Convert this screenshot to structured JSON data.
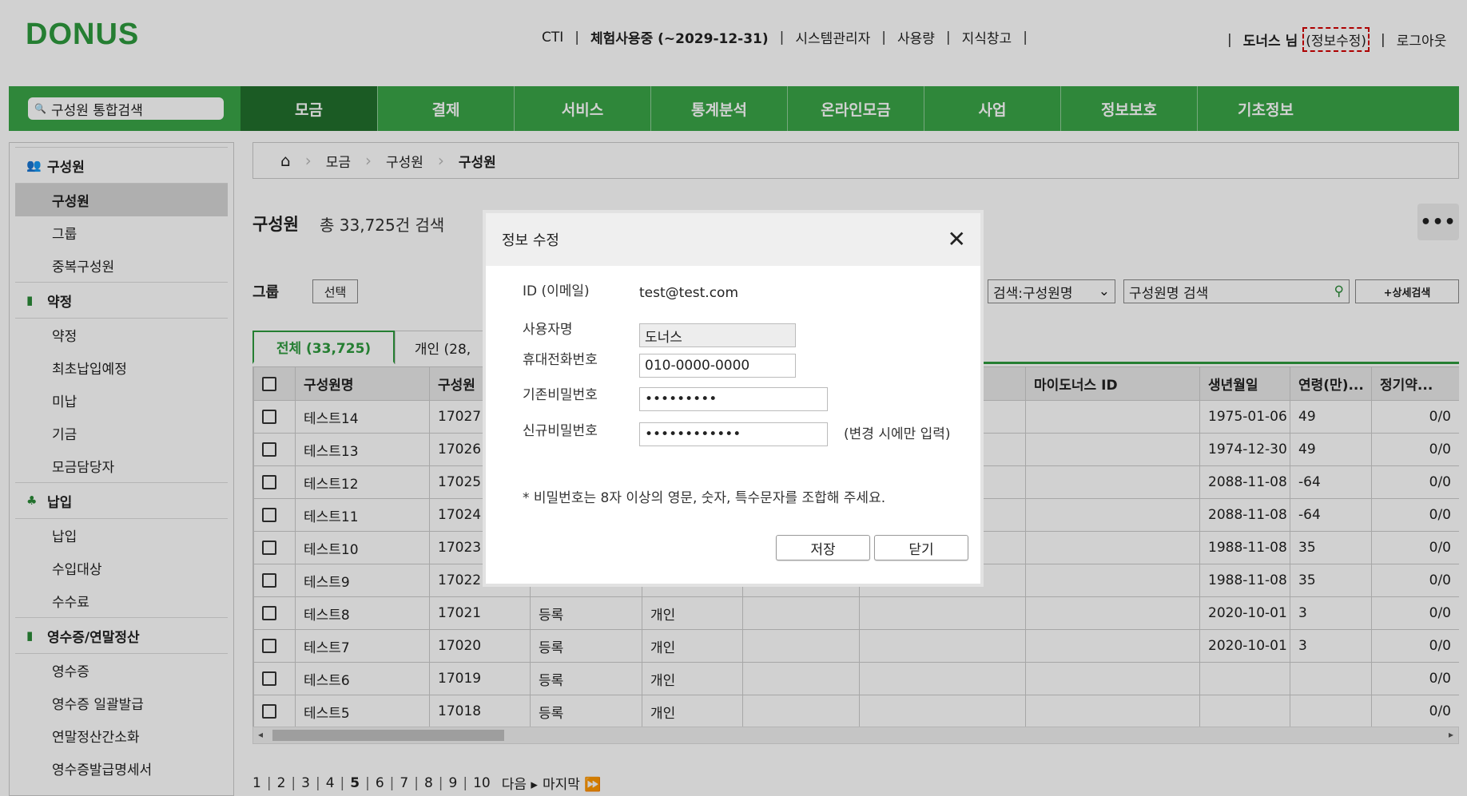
{
  "app": {
    "logo": "DONUS"
  },
  "topnav": {
    "cti": "CTI",
    "trial": "체험사용중 (~2029-12-31)",
    "sysadmin": "시스템관리자",
    "usage": "사용량",
    "knowledge": "지식창고",
    "user_name": "도너스 님",
    "edit_info": "(정보수정)",
    "logout": "로그아웃",
    "separator": "|"
  },
  "menubar": {
    "search_placeholder": "구성원 통합검색",
    "items": [
      "모금",
      "결제",
      "서비스",
      "통계분석",
      "온라인모금",
      "사업",
      "정보보호",
      "기초정보"
    ],
    "active_index": 0
  },
  "sidebar": {
    "sections": [
      {
        "title": "구성원",
        "icon": "people-icon",
        "items": [
          "구성원",
          "그룹",
          "중복구성원"
        ]
      },
      {
        "title": "약정",
        "icon": "document-icon",
        "items": [
          "약정",
          "최초납입예정",
          "미납",
          "기금",
          "모금담당자"
        ]
      },
      {
        "title": "납입",
        "icon": "bell-icon",
        "items": [
          "납입",
          "수입대상",
          "수수료"
        ]
      },
      {
        "title": "영수증/연말정산",
        "icon": "receipt-icon",
        "items": [
          "영수증",
          "영수증 일괄발급",
          "연말정산간소화",
          "영수증발급명세서"
        ]
      }
    ],
    "active_item": "구성원"
  },
  "breadcrumb": [
    "모금",
    "구성원",
    "구성원"
  ],
  "page": {
    "title": "구성원",
    "count_text": "총 33,725건 검색",
    "more": "•••"
  },
  "filters": {
    "group_label": "그룹",
    "group_button": "선택",
    "search_select": "검색:구성원명",
    "search_placeholder": "구성원명 검색",
    "advanced_button": "+상세검색"
  },
  "tabs": [
    "전체 (33,725)",
    "개인 (28,"
  ],
  "table": {
    "columns": [
      "",
      "구성원명",
      "구성원",
      "",
      "",
      "",
      "",
      "마이도너스 ID",
      "생년월일",
      "연령(만)...",
      "정기약...",
      "("
    ],
    "rows": [
      [
        "테스트14",
        "17027",
        "",
        "",
        "",
        "",
        "",
        "1975-01-06",
        "49",
        "0/0"
      ],
      [
        "테스트13",
        "17026",
        "",
        "",
        "",
        "",
        "",
        "1974-12-30",
        "49",
        "0/0"
      ],
      [
        "테스트12",
        "17025",
        "",
        "",
        "",
        "",
        "",
        "2088-11-08",
        "-64",
        "0/0"
      ],
      [
        "테스트11",
        "17024",
        "",
        "",
        "",
        "",
        "",
        "2088-11-08",
        "-64",
        "0/0"
      ],
      [
        "테스트10",
        "17023",
        "",
        "",
        "",
        "",
        "",
        "1988-11-08",
        "35",
        "0/0"
      ],
      [
        "테스트9",
        "17022",
        "",
        "",
        "",
        "",
        "",
        "1988-11-08",
        "35",
        "0/0"
      ],
      [
        "테스트8",
        "17021",
        "등록",
        "개인",
        "",
        "",
        "",
        "2020-10-01",
        "3",
        "0/0"
      ],
      [
        "테스트7",
        "17020",
        "등록",
        "개인",
        "",
        "",
        "",
        "2020-10-01",
        "3",
        "0/0"
      ],
      [
        "테스트6",
        "17019",
        "등록",
        "개인",
        "",
        "",
        "",
        "",
        "",
        "0/0"
      ],
      [
        "테스트5",
        "17018",
        "등록",
        "개인",
        "",
        "",
        "",
        "",
        "",
        "0/0"
      ]
    ]
  },
  "pagination": {
    "pages": [
      "1",
      "2",
      "3",
      "4",
      "5",
      "6",
      "7",
      "8",
      "9",
      "10"
    ],
    "current": "5",
    "next": "다음 ▸",
    "last": "마지막 ⏩"
  },
  "modal": {
    "title": "정보 수정",
    "close": "✕",
    "fields": {
      "id_label": "ID (이메일)",
      "id_value": "test@test.com",
      "name_label": "사용자명",
      "name_value": "도너스",
      "phone_label": "휴대전화번호",
      "phone_value": "010-0000-0000",
      "old_pw_label": "기존비밀번호",
      "old_pw_value": "•••••••••",
      "new_pw_label": "신규비밀번호",
      "new_pw_value": "••••••••••••",
      "new_pw_hint": "(변경 시에만 입력)"
    },
    "note": "* 비밀번호는 8자 이상의 영문, 숫자, 특수문자를 조합해 주세요.",
    "save": "저장",
    "close_button": "닫기"
  },
  "colors": {
    "brand_green": "#3aa547",
    "active_menu": "#22702c",
    "highlight_dash": "#d40000"
  }
}
